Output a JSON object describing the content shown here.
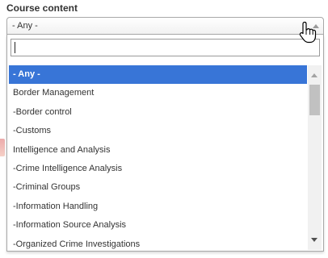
{
  "field": {
    "label": "Course content",
    "selected_value": "- Any -"
  },
  "search": {
    "value": "",
    "placeholder": ""
  },
  "options": [
    "- Any -",
    "Border Management",
    "-Border control",
    "-Customs",
    "Intelligence and Analysis",
    "-Crime Intelligence Analysis",
    "-Criminal Groups",
    "-Information Handling",
    "-Information Source Analysis",
    "-Organized Crime Investigations"
  ],
  "highlighted_index": 0,
  "colors": {
    "highlight": "#3875d7",
    "border": "#a8a8a8",
    "text": "#333333"
  },
  "icons": {
    "cursor": "hand-pointer-icon",
    "select_arrow": "chevron-up-icon"
  }
}
